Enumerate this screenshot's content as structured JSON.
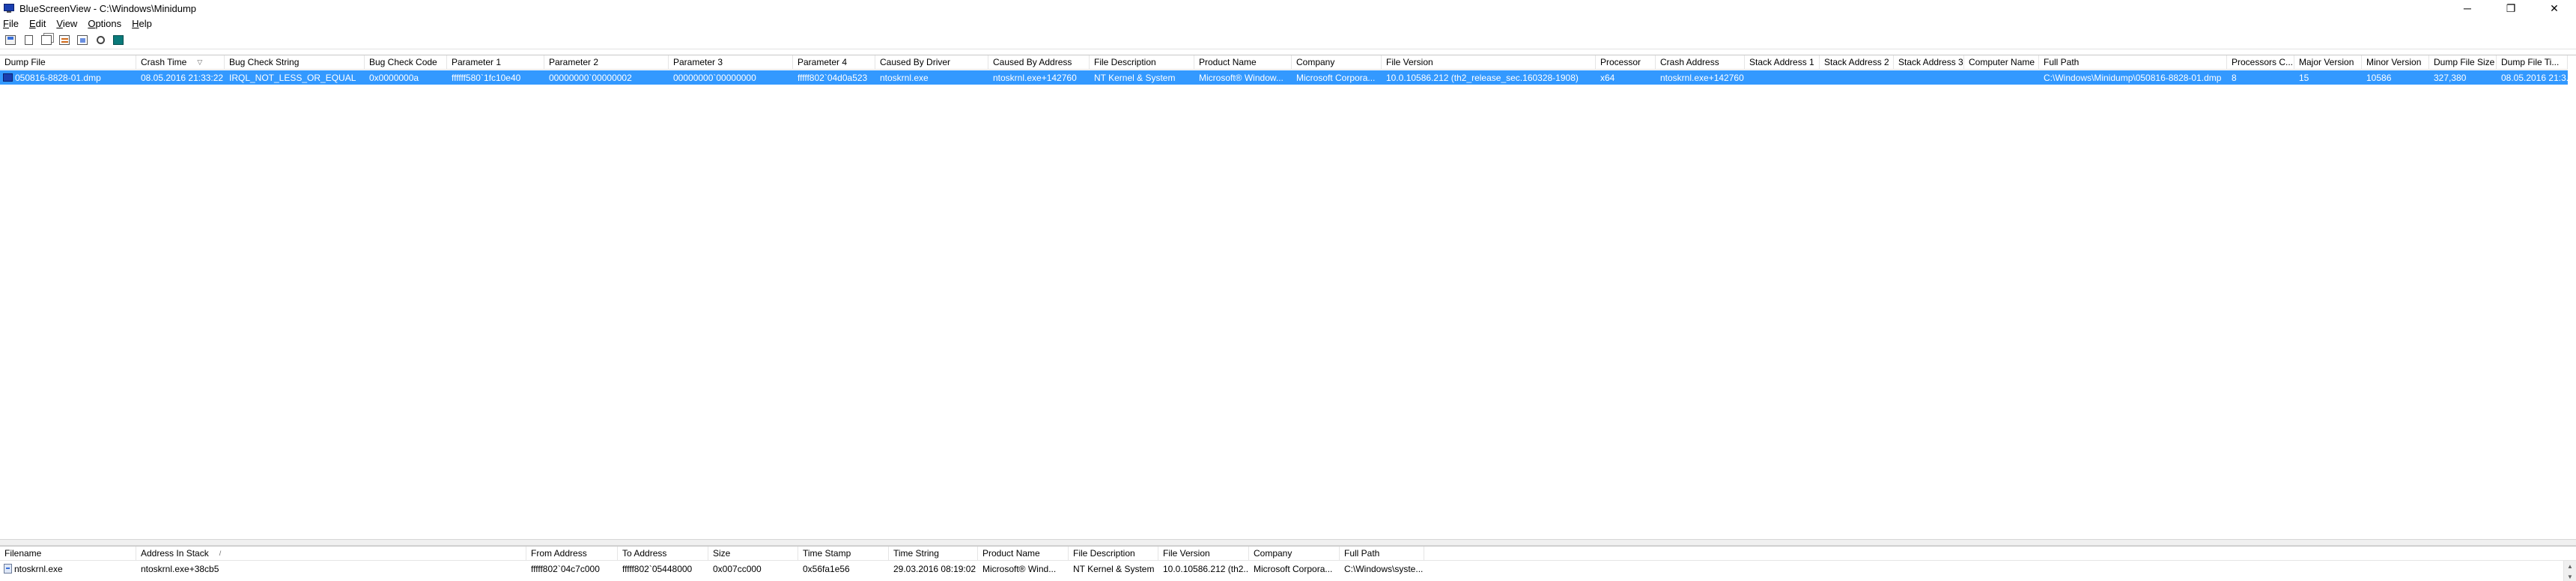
{
  "window": {
    "title": "BlueScreenView  -  C:\\Windows\\Minidump",
    "minimize": "─",
    "restore": "❐",
    "close": "✕"
  },
  "menu": [
    {
      "key": "F",
      "rest": "ile"
    },
    {
      "key": "E",
      "rest": "dit"
    },
    {
      "key": "V",
      "rest": "iew"
    },
    {
      "key": "O",
      "rest": "ptions"
    },
    {
      "key": "H",
      "rest": "elp"
    }
  ],
  "toolbar": {
    "icons": [
      "save-icon",
      "document-icon",
      "copy-icon",
      "html-report-icon",
      "properties-icon",
      "find-icon",
      "exit-icon"
    ]
  },
  "dumps": {
    "columns": [
      "Dump File",
      "Crash Time",
      "Bug Check String",
      "Bug Check Code",
      "Parameter 1",
      "Parameter 2",
      "Parameter 3",
      "Parameter 4",
      "Caused By Driver",
      "Caused By Address",
      "File Description",
      "Product Name",
      "Company",
      "File Version",
      "Processor",
      "Crash Address",
      "Stack Address 1",
      "Stack Address 2",
      "Stack Address 3",
      "Computer Name",
      "Full Path",
      "Processors C...",
      "Major Version",
      "Minor Version",
      "Dump File Size",
      "Dump File Ti..."
    ],
    "sort_indicator": "▽",
    "rows": [
      {
        "selected": true,
        "cells": [
          "050816-8828-01.dmp",
          "08.05.2016 21:33:22",
          "IRQL_NOT_LESS_OR_EQUAL",
          "0x0000000a",
          "ffffff580`1fc10e40",
          "00000000`00000002",
          "00000000`00000000",
          "fffff802`04d0a523",
          "ntoskrnl.exe",
          "ntoskrnl.exe+142760",
          "NT Kernel & System",
          "Microsoft® Window...",
          "Microsoft Corpora...",
          "10.0.10586.212 (th2_release_sec.160328-1908)",
          "x64",
          "ntoskrnl.exe+142760",
          "",
          "",
          "",
          "",
          "C:\\Windows\\Minidump\\050816-8828-01.dmp",
          "8",
          "15",
          "10586",
          "327,380",
          "08.05.2016 21:3..."
        ]
      }
    ]
  },
  "modules": {
    "columns": [
      "Filename",
      "Address In Stack",
      "From Address",
      "To Address",
      "Size",
      "Time Stamp",
      "Time String",
      "Product Name",
      "File Description",
      "File Version",
      "Company",
      "Full Path"
    ],
    "sort_indicator": "/",
    "rows": [
      {
        "cells": [
          "ntoskrnl.exe",
          "ntoskrnl.exe+38cb5",
          "fffff802`04c7c000",
          "fffff802`05448000",
          "0x007cc000",
          "0x56fa1e56",
          "29.03.2016 08:19:02",
          "Microsoft® Wind...",
          "NT Kernel & System",
          "10.0.10586.212 (th2...",
          "Microsoft Corpora...",
          "C:\\Windows\\syste..."
        ]
      }
    ]
  },
  "colors": {
    "selection": "#3399ff",
    "selection_text": "#ffffff"
  }
}
